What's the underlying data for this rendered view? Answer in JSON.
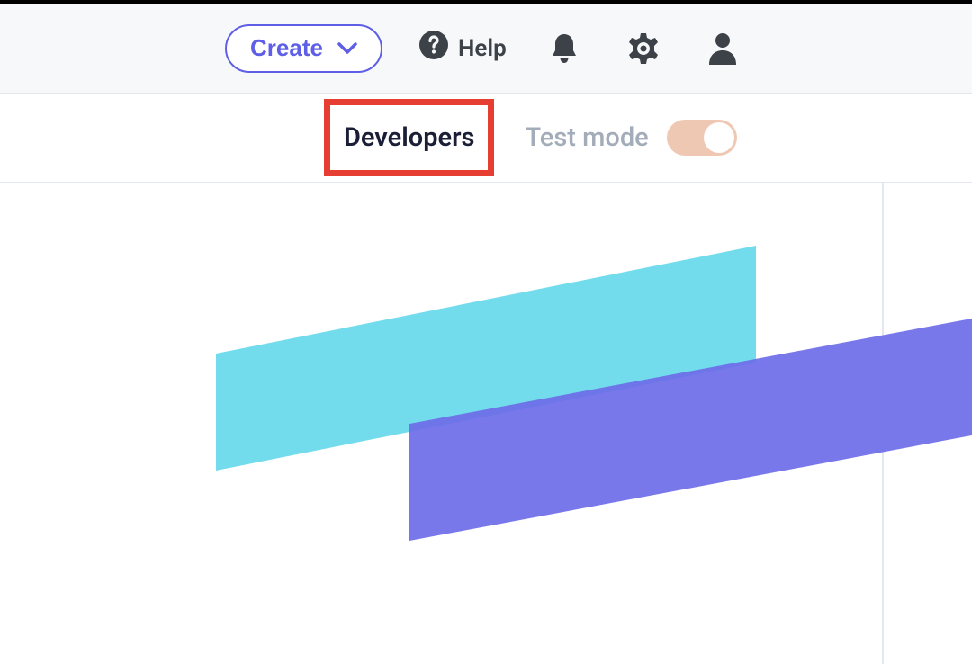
{
  "topbar": {
    "create_label": "Create",
    "help_label": "Help"
  },
  "subbar": {
    "developers_label": "Developers",
    "testmode_label": "Test mode",
    "testmode_on": true
  },
  "colors": {
    "accent_blue": "#5e5ee6",
    "highlight_red": "#e63e32",
    "toggle_track": "#efc8b3",
    "stripe_cyan": "#6ad9eb",
    "stripe_indigo": "#6c6ce8"
  }
}
